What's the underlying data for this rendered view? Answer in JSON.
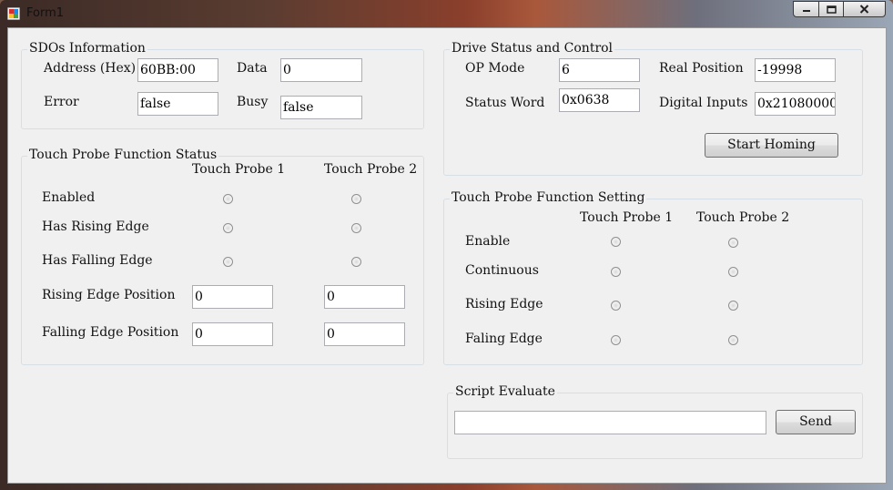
{
  "window": {
    "title": "Form1"
  },
  "sdo": {
    "title": "SDOs Information",
    "address_label": "Address (Hex)",
    "address_value": "60BB:00",
    "data_label": "Data",
    "data_value": "0",
    "error_label": "Error",
    "error_value": "false",
    "busy_label": "Busy",
    "busy_value": "false"
  },
  "drive": {
    "title": "Drive Status and Control",
    "op_mode_label": "OP Mode",
    "op_mode_value": "6",
    "real_position_label": "Real Position",
    "real_position_value": "-19998",
    "status_word_label": "Status Word",
    "status_word_value": "0x0638",
    "digital_inputs_label": "Digital Inputs",
    "digital_inputs_value": "0x21080000",
    "start_homing_label": "Start Homing"
  },
  "tp_status": {
    "title": "Touch Probe Function Status",
    "col1": "Touch Probe 1",
    "col2": "Touch Probe 2",
    "enabled_label": "Enabled",
    "has_rising_label": "Has Rising Edge",
    "has_falling_label": "Has Falling Edge",
    "rising_pos_label": "Rising Edge Position",
    "falling_pos_label": "Falling Edge Position",
    "rising_pos_1": "0",
    "rising_pos_2": "0",
    "falling_pos_1": "0",
    "falling_pos_2": "0"
  },
  "tp_setting": {
    "title": "Touch Probe Function Setting",
    "col1": "Touch Probe 1",
    "col2": "Touch Probe 2",
    "enable_label": "Enable",
    "continuous_label": "Continuous",
    "rising_label": "Rising Edge",
    "falling_label": "Faling Edge"
  },
  "script": {
    "title": "Script Evaluate",
    "input_value": "",
    "send_label": "Send"
  }
}
